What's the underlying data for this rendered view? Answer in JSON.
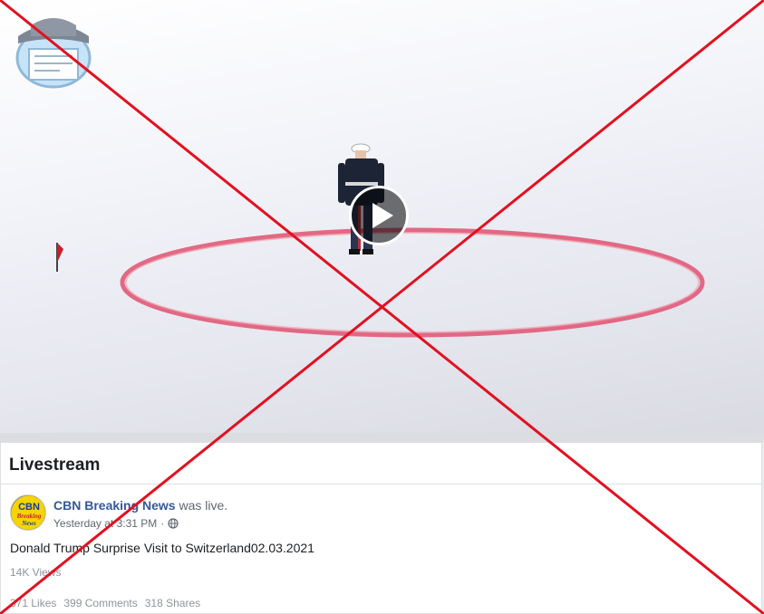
{
  "video": {
    "play_icon": "play-icon",
    "watermark_icon": "detective-newspaper-logo"
  },
  "panel": {
    "title": "Livestream",
    "post": {
      "author": "CBN Breaking News",
      "action": "was live.",
      "timestamp": "Yesterday at 3:31 PM",
      "separator": "·",
      "privacy_icon": "globe-icon",
      "avatar_text_top": "CBN",
      "avatar_text_mid": "Breaking",
      "avatar_text_bottom": "News",
      "text": "Donald Trump Surprise Visit to Switzerland02.03.2021",
      "views": "14K Views",
      "likes": "371 Likes",
      "comments": "399 Comments",
      "shares": "318 Shares"
    }
  },
  "overlay": {
    "cross_color": "#e3101f",
    "meaning": "false-claim-cross"
  }
}
